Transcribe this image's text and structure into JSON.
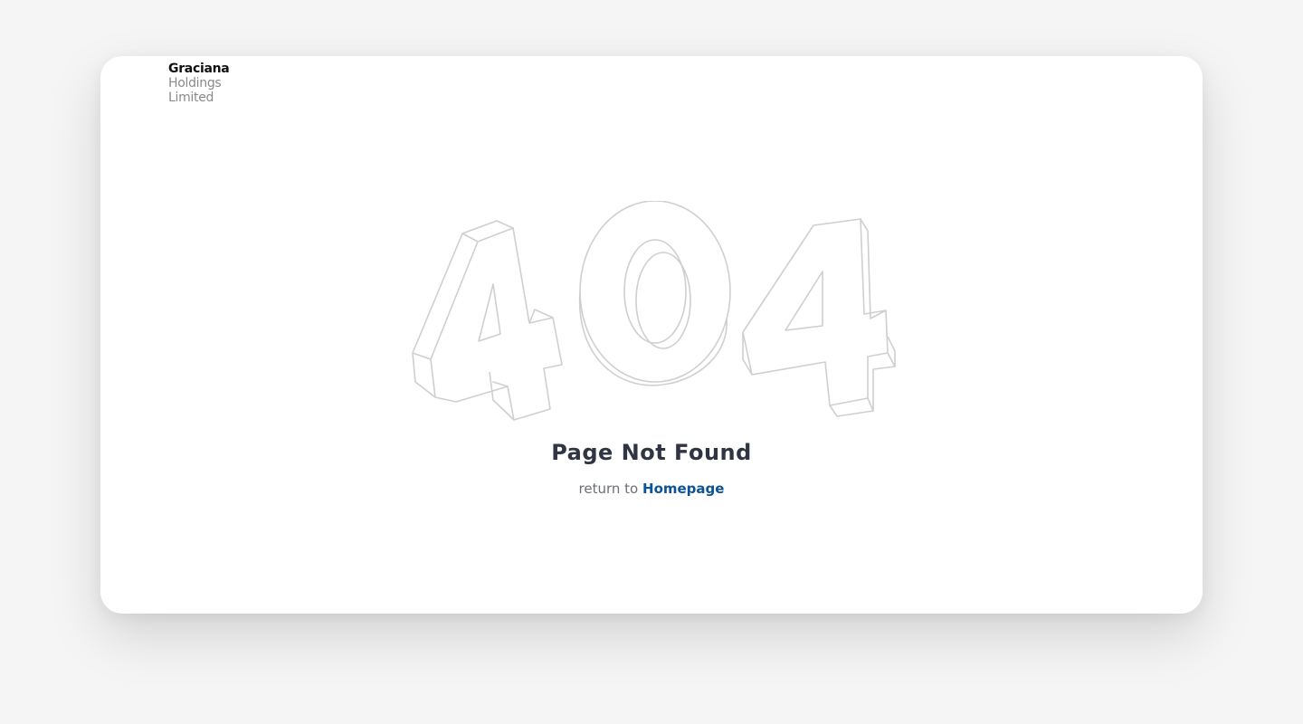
{
  "logo": {
    "line1": "Graciana",
    "line2": "Holdings",
    "line3": "Limited"
  },
  "error": {
    "code": "404",
    "title": "Page Not Found",
    "return_prefix": "return to",
    "return_link": "Homepage"
  },
  "colors": {
    "background": "#f5f5f5",
    "card": "#ffffff",
    "title": "#2f3542",
    "link": "#0b5395",
    "outline": "#cfcfcf"
  },
  "icons": {
    "art": "outlined-3d-404-illustration"
  }
}
